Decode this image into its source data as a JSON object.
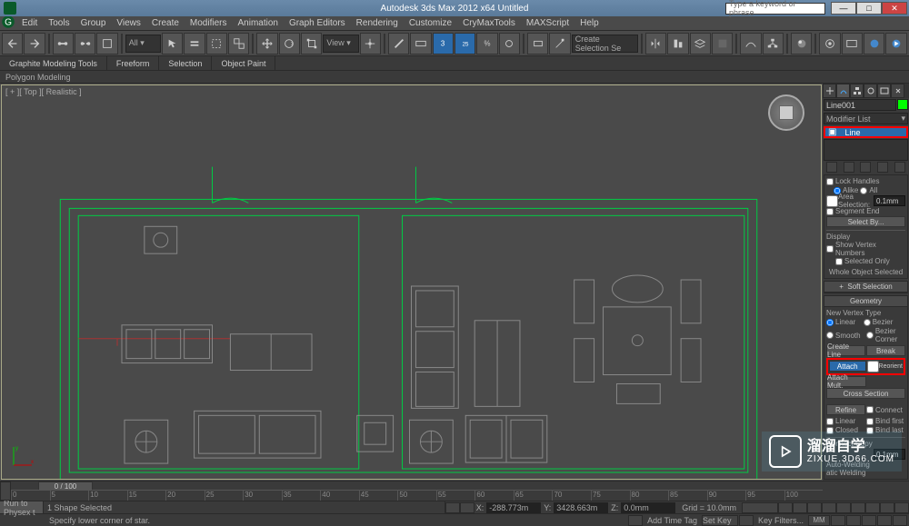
{
  "titlebar": {
    "title": "Autodesk 3ds Max 2012 x64   Untitled",
    "search_placeholder": "Type a keyword or phrase"
  },
  "menus": [
    "Edit",
    "Tools",
    "Group",
    "Views",
    "Create",
    "Modifiers",
    "Animation",
    "Graph Editors",
    "Rendering",
    "Customize",
    "CryMaxTools",
    "MAXScript",
    "Help"
  ],
  "ribbon": {
    "tabs": [
      "Graphite Modeling Tools",
      "Freeform",
      "Selection",
      "Object Paint"
    ],
    "sub": "Polygon Modeling"
  },
  "viewport": {
    "label": "[ + ][ Top ][ Realistic ]"
  },
  "command_panel": {
    "object_name": "Line001",
    "modifier_list": "Modifier List",
    "stack_selected": "Line",
    "rollouts": {
      "lock_handles": "Lock Handles",
      "alike": "Alike",
      "all": "All",
      "area_selection": "Area Selection:",
      "area_val": "0.1mm",
      "segment_end": "Segment End",
      "select_by": "Select By...",
      "display": "Display",
      "show_vertex_numbers": "Show Vertex Numbers",
      "selected_only": "Selected Only",
      "whole_selected": "Whole Object Selected",
      "soft_selection": "Soft Selection",
      "geometry": "Geometry",
      "new_vertex_type": "New Vertex Type",
      "linear": "Linear",
      "bezier": "Bezier",
      "smooth": "Smooth",
      "bezier_corner": "Bezier Corner",
      "create_line": "Create Line",
      "break": "Break",
      "attach": "Attach",
      "reorient": "Reorient",
      "attach_mult": "Attach Mult.",
      "cross_section": "Cross Section",
      "refine": "Refine",
      "connect": "Connect",
      "linear2": "Linear",
      "bind_first": "Bind first",
      "closed": "Closed",
      "bind_last": "Bind last",
      "connect_copy": "Connect Copy",
      "threshold_val": "0.1mm",
      "auto_welding": "Auto-Welding",
      "atic_welding": "atic Welding"
    }
  },
  "timeline": {
    "slider": "0 / 100",
    "ticks": [
      "0",
      "5",
      "10",
      "15",
      "20",
      "25",
      "30",
      "35",
      "40",
      "45",
      "50",
      "55",
      "60",
      "65",
      "70",
      "75",
      "80",
      "85",
      "90",
      "95",
      "100"
    ]
  },
  "statusbar": {
    "selected": "1 Shape Selected",
    "x": "-288.773m",
    "y": "3428.663m",
    "z": "0.0mm",
    "grid": "Grid = 10.0mm",
    "add_time_tag": "Add Time Tag",
    "script_btn": "Run to Physex t",
    "prompt": "Specify lower corner of star.",
    "set_key": "Set Key",
    "key_filters": "Key Filters...",
    "mm": "MM"
  },
  "watermark": {
    "cn": "溜溜自学",
    "url": "ZIXUE.3D66.COM"
  },
  "toolbar_dropdown": "Create Selection Se"
}
